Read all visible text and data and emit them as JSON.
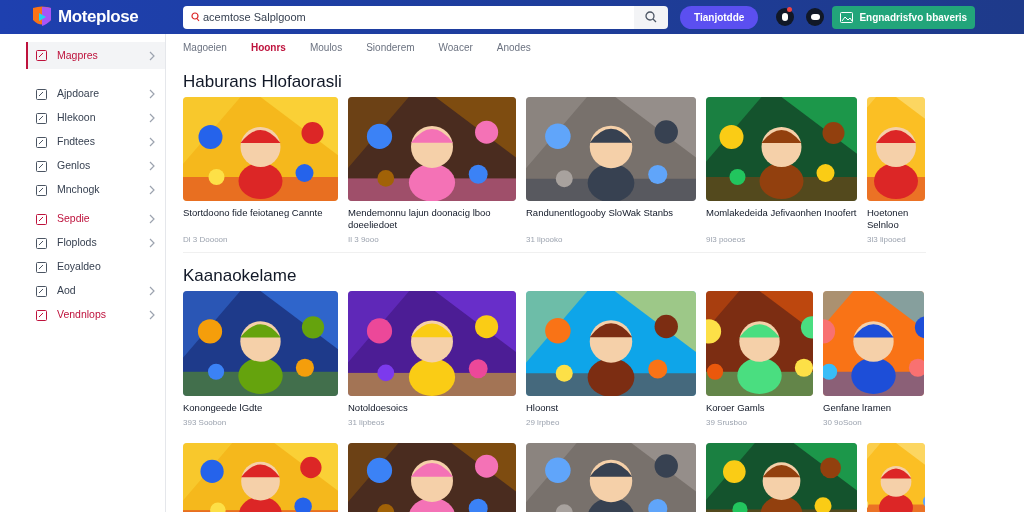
{
  "header": {
    "logo": "Moteplose",
    "search": {
      "placeholder": "acemtose Salplgoom"
    },
    "primary_button": "Tianjotdde",
    "action_button": "Engnadrisfvo bbaveris"
  },
  "sidebar": {
    "items": [
      {
        "label": "Magpres",
        "selected": true,
        "accent": true,
        "chevron": true
      },
      {
        "label": "Ajpdoare",
        "selected": false,
        "accent": false,
        "chevron": true
      },
      {
        "label": "Hlekoon",
        "selected": false,
        "accent": false,
        "chevron": true
      },
      {
        "label": "Fndtees",
        "selected": false,
        "accent": false,
        "chevron": true
      },
      {
        "label": "Genlos",
        "selected": false,
        "accent": false,
        "chevron": true
      },
      {
        "label": "Mnchogk",
        "selected": false,
        "accent": false,
        "chevron": true
      },
      {
        "label": "Sepdie",
        "selected": false,
        "accent": true,
        "chevron": true
      },
      {
        "label": "Floplods",
        "selected": false,
        "accent": false,
        "chevron": true
      },
      {
        "label": "Eoyaldeo",
        "selected": false,
        "accent": false,
        "chevron": false
      },
      {
        "label": "Aod",
        "selected": false,
        "accent": false,
        "chevron": true
      },
      {
        "label": "Vendnlops",
        "selected": false,
        "accent": true,
        "chevron": true
      }
    ]
  },
  "tabs": [
    {
      "label": "Magoeien",
      "selected": false
    },
    {
      "label": "Hoonrs",
      "selected": true
    },
    {
      "label": "Moulos",
      "selected": false
    },
    {
      "label": "Sionderem",
      "selected": false
    },
    {
      "label": "Woacer",
      "selected": false
    },
    {
      "label": "Anodes",
      "selected": false
    }
  ],
  "sections": [
    {
      "title": "Haburans Hlofaorasli",
      "cards": [
        {
          "kind": "game",
          "title": "Stortdoono fide feiotaneg Cannte",
          "meta": "Dl 3 Doooon"
        },
        {
          "kind": "game",
          "title": "Mendemonnu lajun doonacig lboo doeeliedoet",
          "meta": "Il 3 9ooo"
        },
        {
          "kind": "game",
          "title": "Randunentlogooby SloWak Stanbs",
          "meta": "31 lipooko"
        },
        {
          "kind": "game",
          "title": "Momlakedeida Jefivaonhen Inoofert",
          "meta": "9l3 pooeos"
        },
        {
          "kind": "game",
          "title": "Hoetonen Selnloo",
          "meta": "3l3 lipooed"
        }
      ]
    },
    {
      "title": "Kaanaokelame",
      "cards": [
        {
          "kind": "game",
          "title": "Konongeede lGdte",
          "meta": "393 Soobon"
        },
        {
          "kind": "game",
          "title": "Notoldoesoics",
          "meta": "31 lipbeos"
        },
        {
          "kind": "game",
          "title": "Hloonst",
          "meta": "29 lrpbeo"
        },
        {
          "kind": "game",
          "title": "Koroer Gamls",
          "meta": "39 Srusboo"
        },
        {
          "kind": "game",
          "title": "Genfane lramen",
          "meta": "30 9oSoon"
        }
      ]
    },
    {
      "cards": [
        {
          "kind": "picture"
        },
        {
          "kind": "picture"
        },
        {
          "kind": "picture"
        },
        {
          "kind": "picture"
        },
        {
          "kind": "picture"
        }
      ]
    }
  ]
}
